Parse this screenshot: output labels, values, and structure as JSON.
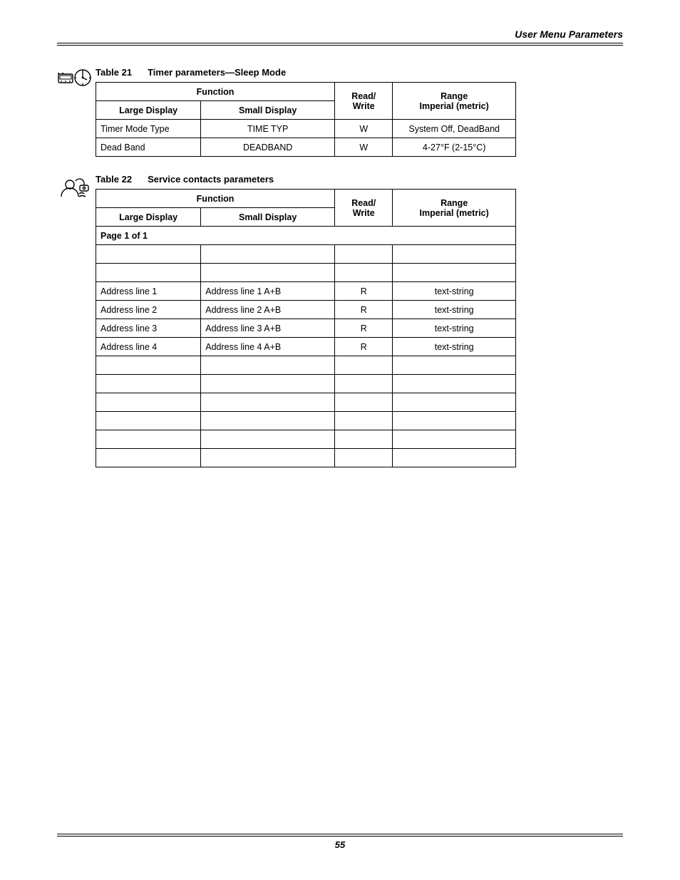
{
  "header": {
    "section_title": "User Menu Parameters"
  },
  "footer": {
    "page_number": "55"
  },
  "table21": {
    "label": "Table 21",
    "title": "Timer parameters—Sleep Mode",
    "headers": {
      "function": "Function",
      "large": "Large Display",
      "small": "Small Display",
      "rw_1": "Read/",
      "rw_2": "Write",
      "range_1": "Range",
      "range_2": "Imperial (metric)"
    },
    "rows": [
      {
        "large": "Timer Mode Type",
        "small": "TIME TYP",
        "rw": "W",
        "range": "System Off, DeadBand"
      },
      {
        "large": "Dead Band",
        "small": "DEADBAND",
        "rw": "W",
        "range": "4-27°F (2-15°C)"
      }
    ]
  },
  "table22": {
    "label": "Table 22",
    "title": "Service contacts parameters",
    "headers": {
      "function": "Function",
      "large": "Large Display",
      "small": "Small Display",
      "rw_1": "Read/",
      "rw_2": "Write",
      "range_1": "Range",
      "range_2": "Imperial (metric)"
    },
    "section": "Page 1 of 1",
    "rows": [
      {
        "large": "",
        "small": "",
        "rw": "",
        "range": ""
      },
      {
        "large": "",
        "small": "",
        "rw": "",
        "range": ""
      },
      {
        "large": "Address line 1",
        "small": "Address line 1 A+B",
        "rw": "R",
        "range": "text-string"
      },
      {
        "large": "Address line 2",
        "small": "Address line 2 A+B",
        "rw": "R",
        "range": "text-string"
      },
      {
        "large": "Address line 3",
        "small": "Address line 3 A+B",
        "rw": "R",
        "range": "text-string"
      },
      {
        "large": "Address line 4",
        "small": "Address line 4 A+B",
        "rw": "R",
        "range": "text-string"
      },
      {
        "large": "",
        "small": "",
        "rw": "",
        "range": ""
      },
      {
        "large": "",
        "small": "",
        "rw": "",
        "range": ""
      },
      {
        "large": "",
        "small": "",
        "rw": "",
        "range": ""
      },
      {
        "large": "",
        "small": "",
        "rw": "",
        "range": ""
      },
      {
        "large": "",
        "small": "",
        "rw": "",
        "range": ""
      },
      {
        "large": "",
        "small": "",
        "rw": "",
        "range": ""
      }
    ]
  }
}
